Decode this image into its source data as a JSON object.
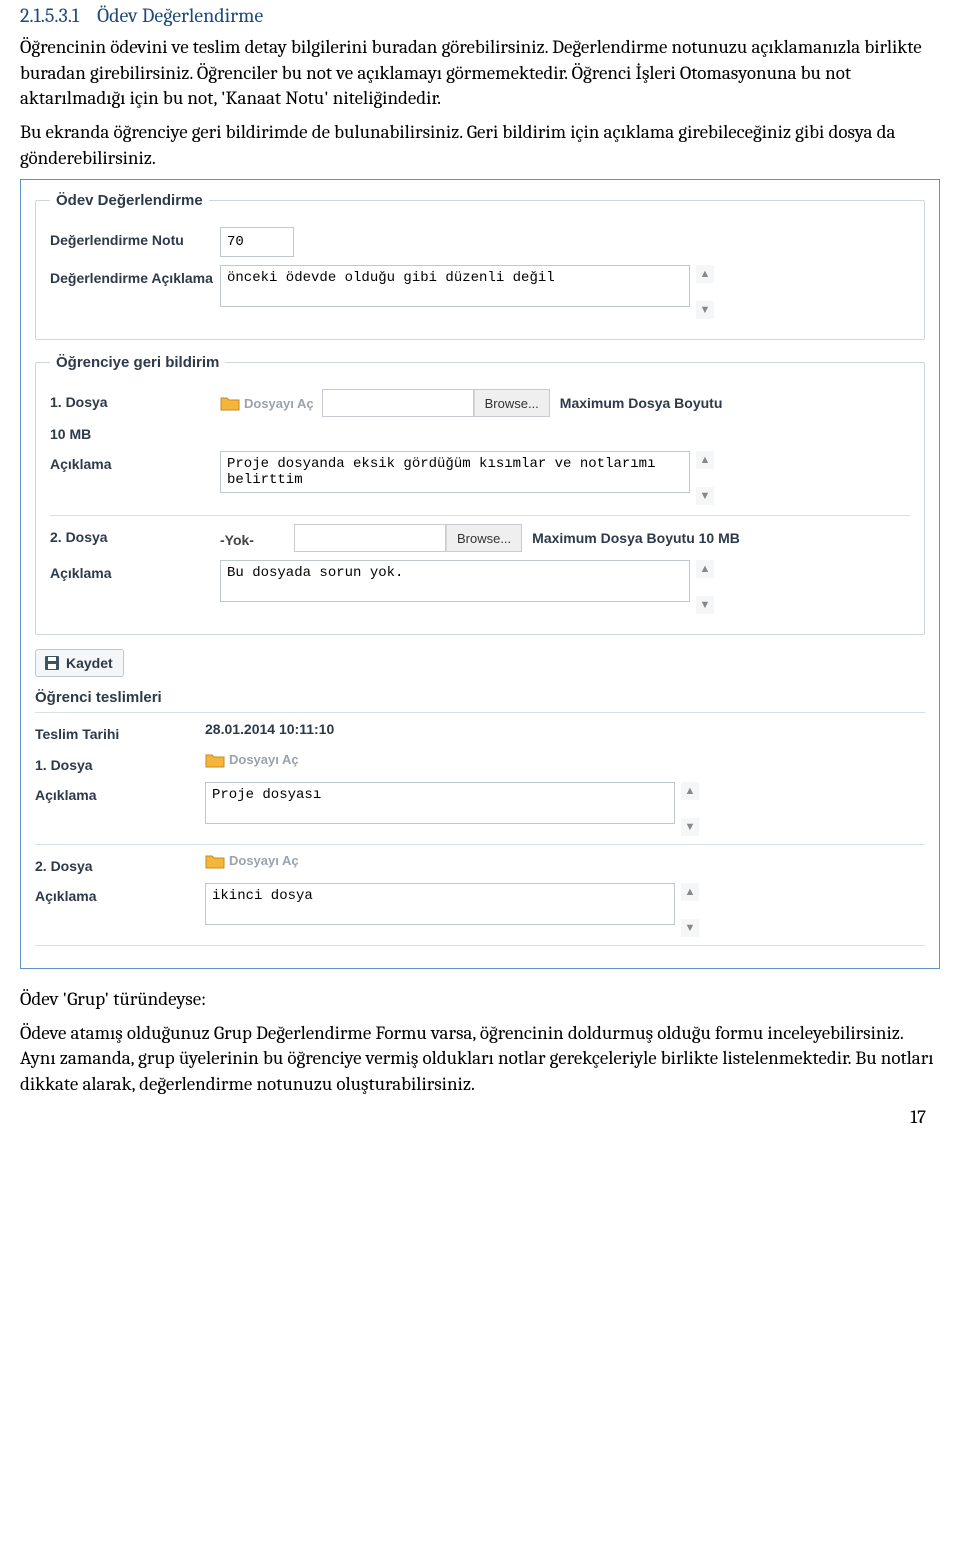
{
  "heading": {
    "number": "2.1.5.3.1",
    "title": "Ödev Değerlendirme"
  },
  "intro": {
    "p1": "Öğrencinin ödevini ve teslim detay bilgilerini buradan görebilirsiniz. Değerlendirme notunuzu açıklamanızla birlikte buradan girebilirsiniz. Öğrenciler bu not ve açıklamayı görmemektedir. Öğrenci İşleri Otomasyonuna bu not aktarılmadığı için bu not, 'Kanaat Notu' niteliğindedir.",
    "p2": "Bu ekranda öğrenciye geri bildirimde de bulunabilirsiniz. Geri bildirim için açıklama girebileceğiniz gibi dosya da gönderebilirsiniz."
  },
  "evaluation": {
    "legend": "Ödev Değerlendirme",
    "grade_label": "Değerlendirme Notu",
    "grade_value": "70",
    "desc_label": "Değerlendirme Açıklama",
    "desc_value": "önceki ödevde olduğu gibi düzenli değil"
  },
  "feedback": {
    "legend": "Öğrenciye geri bildirim",
    "file1_label": "1. Dosya",
    "file2_label": "2. Dosya",
    "open_label": "Dosyayı Aç",
    "browse_label": "Browse...",
    "max_size_label": "Maximum Dosya Boyutu 10 MB",
    "max_size_trail_1a": "Maximum Dosya Boyutu",
    "max_size_trail_1b": "10 MB",
    "desc_label": "Açıklama",
    "desc1_value": "Proje dosyanda eksik gördüğüm kısımlar ve notlarımı belirttim",
    "file2_value": "-Yok-",
    "desc2_value": "Bu dosyada sorun yok."
  },
  "save_label": "Kaydet",
  "submissions": {
    "heading": "Öğrenci teslimleri",
    "date_label": "Teslim Tarihi",
    "date_value": "28.01.2014 10:11:10",
    "file1_label": "1. Dosya",
    "file2_label": "2. Dosya",
    "open_label": "Dosyayı Aç",
    "desc_label": "Açıklama",
    "desc1_value": "Proje dosyası",
    "desc2_value": "ikinci dosya"
  },
  "outro": {
    "h": "Ödev 'Grup' türündeyse:",
    "p": "Ödeve atamış olduğunuz Grup Değerlendirme Formu varsa, öğrencinin doldurmuş olduğu formu inceleyebilirsiniz. Aynı zamanda, grup üyelerinin bu öğrenciye vermiş oldukları notlar gerekçeleriyle birlikte listelenmektedir. Bu notları dikkate alarak, değerlendirme notunuzu oluşturabilirsiniz."
  },
  "page_number": "17"
}
